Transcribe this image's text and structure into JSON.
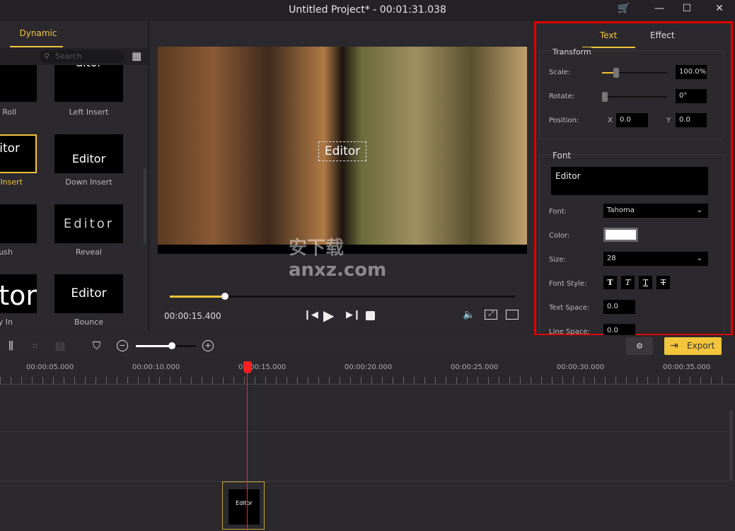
{
  "window": {
    "title": "Untitled Project* - 00:01:31.038",
    "cart_icon": "cart-icon",
    "minimize": "—",
    "maximize": "☐",
    "close": "✕"
  },
  "left_panel": {
    "tab": "Dynamic",
    "search_placeholder": "Search",
    "items": [
      {
        "label": "wn Roll",
        "thumb": ""
      },
      {
        "label": "Left Insert",
        "thumb": "ditor"
      },
      {
        "label": "Insert",
        "thumb": "itor",
        "selected": true
      },
      {
        "label": "Down Insert",
        "thumb": "Editor"
      },
      {
        "label": "ush",
        "thumb": ""
      },
      {
        "label": "Reveal",
        "thumb": "Editor"
      },
      {
        "label": "y In",
        "thumb": "tor"
      },
      {
        "label": "Bounce",
        "thumb": "Editor"
      }
    ]
  },
  "preview": {
    "overlay_text": "Editor",
    "time": "00:00:15.400",
    "progress": 0.16,
    "watermark": "安下载 anxz.com"
  },
  "right_panel": {
    "tabs": [
      "Text",
      "Effect"
    ],
    "active_tab": "Text",
    "transform": {
      "title": "Transform",
      "scale_label": "Scale:",
      "scale_value": "100.0%",
      "scale_slider": 0.17,
      "rotate_label": "Rotate:",
      "rotate_value": "0°",
      "rotate_slider": 0,
      "position_label": "Position:",
      "x_label": "X",
      "x_value": "0.0",
      "y_label": "Y",
      "y_value": "0.0"
    },
    "font": {
      "title": "Font",
      "text": "Editor",
      "font_label": "Font:",
      "font_value": "Tahoma",
      "color_label": "Color:",
      "color_value": "#ffffff",
      "size_label": "Size:",
      "size_value": "28",
      "style_label": "Font Style:",
      "styles": [
        "T",
        "T",
        "T",
        "T"
      ],
      "text_space_label": "Text Space:",
      "text_space_value": "0.0",
      "line_space_label": "Line Space:",
      "line_space_value": "0.0"
    }
  },
  "toolbar": {
    "export_label": "Export",
    "zoom_level": 0.6
  },
  "timeline": {
    "ticks": [
      "00:00:05.000",
      "00:00:10.000",
      "00:00:15.000",
      "00:00:20.000",
      "00:00:25.000",
      "00:00:30.000",
      "00:00:35.000"
    ],
    "clip_label": "Editor"
  },
  "colors": {
    "accent": "#f2c53d",
    "highlight": "#e00000",
    "playhead": "#ff2020"
  }
}
